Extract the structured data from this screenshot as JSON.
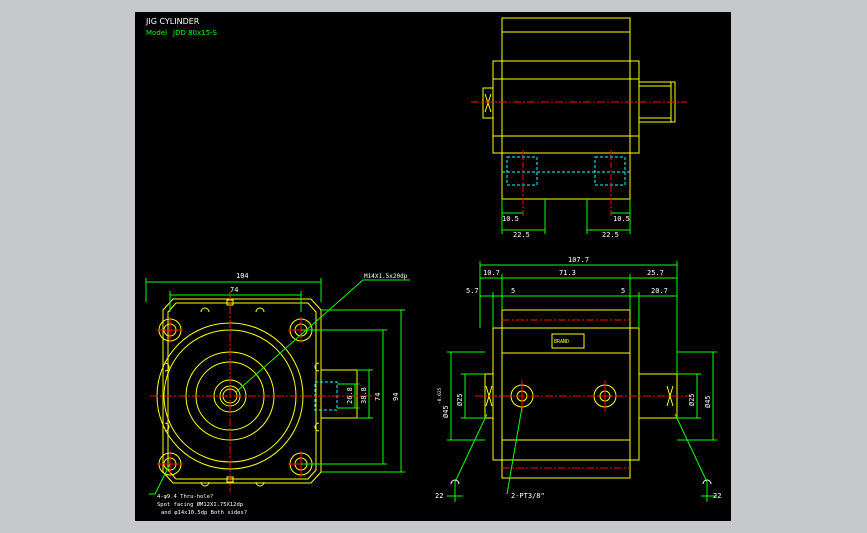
{
  "title": {
    "name": "JIG CYLINDER",
    "model_label": "Model",
    "model_value": "JDD 80x15-S"
  },
  "colors": {
    "background": "#000000",
    "frame": "#c6c8cc",
    "outline": "#ffff00",
    "dimension": "#00ff00",
    "center": "#ff0000",
    "hidden": "#00ffff",
    "text": "#ffffff"
  },
  "top_view": {
    "dims": {
      "left_small": "10.5",
      "right_small": "10.5",
      "left_big": "22.5",
      "right_big": "22.5"
    }
  },
  "front_view": {
    "width_104": "104",
    "bolt_span_74": "74",
    "port_spec": "M14X1.5x20dp",
    "height_94": "94",
    "height_74": "74",
    "height_38_8": "38.8",
    "height_26_8": "26.8",
    "note_line1": "4-φ9.4 Thru-hole?",
    "note_line2": "Spot facing  ØM12X1.75X12dp",
    "note_line3": "and φ14x10.5dp  Both sides?"
  },
  "side_view": {
    "dims": {
      "overall": "107.7",
      "left_seg": "10.7",
      "mid_seg": "71.3",
      "right_seg": "25.7",
      "small_a": "5.7",
      "small_b": "5",
      "small_c": "5",
      "right_end": "20.7",
      "dia_left_outer": "Ø45",
      "dia_left_tol": "-0.025",
      "dia_left_inner": "Ø25",
      "dia_right_inner": "Ø25",
      "dia_right_outer": "Ø45",
      "ports": "2-PT3/8\"",
      "sec_left": "22",
      "sec_right": "22"
    },
    "nameplate": "BRAND"
  }
}
